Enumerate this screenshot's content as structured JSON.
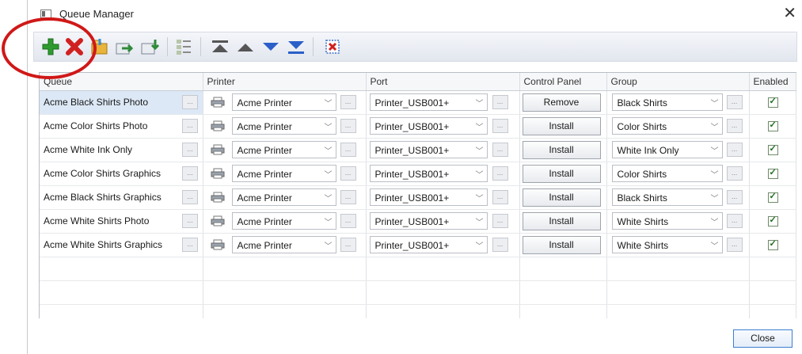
{
  "window": {
    "title": "Queue Manager",
    "close_glyph": "✕"
  },
  "toolbar": {
    "buttons": [
      {
        "name": "add-queue-icon",
        "color": "#2e9b2e"
      },
      {
        "name": "delete-queue-icon",
        "color": "#d02020"
      },
      {
        "name": "import-queue-icon",
        "color": "#d9a22a"
      },
      {
        "name": "export-queue-icon",
        "color": "#3a8fd6"
      },
      {
        "name": "copy-queue-icon",
        "color": "#3a8fd6"
      },
      {
        "name": "list-settings-icon",
        "color": "#7a8a7a"
      },
      {
        "name": "move-top-icon",
        "color": "#555555"
      },
      {
        "name": "move-up-icon",
        "color": "#555555"
      },
      {
        "name": "move-down-icon",
        "color": "#2a5fc9"
      },
      {
        "name": "move-bottom-icon",
        "color": "#2a5fc9"
      },
      {
        "name": "fit-columns-icon",
        "color": "#d02020"
      }
    ]
  },
  "columns": {
    "queue": "Queue",
    "printer": "Printer",
    "port": "Port",
    "control_panel": "Control Panel",
    "group": "Group",
    "enabled": "Enabled"
  },
  "rows": [
    {
      "name": "Acme Black Shirts Photo",
      "printer": "Acme Printer",
      "port": "Printer_USB001+",
      "control_panel": "Remove",
      "group": "Black Shirts",
      "enabled": true
    },
    {
      "name": "Acme Color Shirts Photo",
      "printer": "Acme Printer",
      "port": "Printer_USB001+",
      "control_panel": "Install",
      "group": "Color Shirts",
      "enabled": true
    },
    {
      "name": "Acme White Ink Only",
      "printer": "Acme Printer",
      "port": "Printer_USB001+",
      "control_panel": "Install",
      "group": "White Ink Only",
      "enabled": true
    },
    {
      "name": "Acme Color Shirts Graphics",
      "printer": "Acme Printer",
      "port": "Printer_USB001+",
      "control_panel": "Install",
      "group": "Color Shirts",
      "enabled": true
    },
    {
      "name": "Acme Black Shirts Graphics",
      "printer": "Acme Printer",
      "port": "Printer_USB001+",
      "control_panel": "Install",
      "group": "Black Shirts",
      "enabled": true
    },
    {
      "name": "Acme White Shirts Photo",
      "printer": "Acme Printer",
      "port": "Printer_USB001+",
      "control_panel": "Install",
      "group": "White Shirts",
      "enabled": true
    },
    {
      "name": "Acme White Shirts Graphics",
      "printer": "Acme Printer",
      "port": "Printer_USB001+",
      "control_panel": "Install",
      "group": "White Shirts",
      "enabled": true
    }
  ],
  "ellipsis": "...",
  "footer": {
    "close_label": "Close"
  },
  "colors": {
    "selection": "#dce8f6",
    "annotation": "#d01818",
    "close_border": "#3c7fd0"
  }
}
